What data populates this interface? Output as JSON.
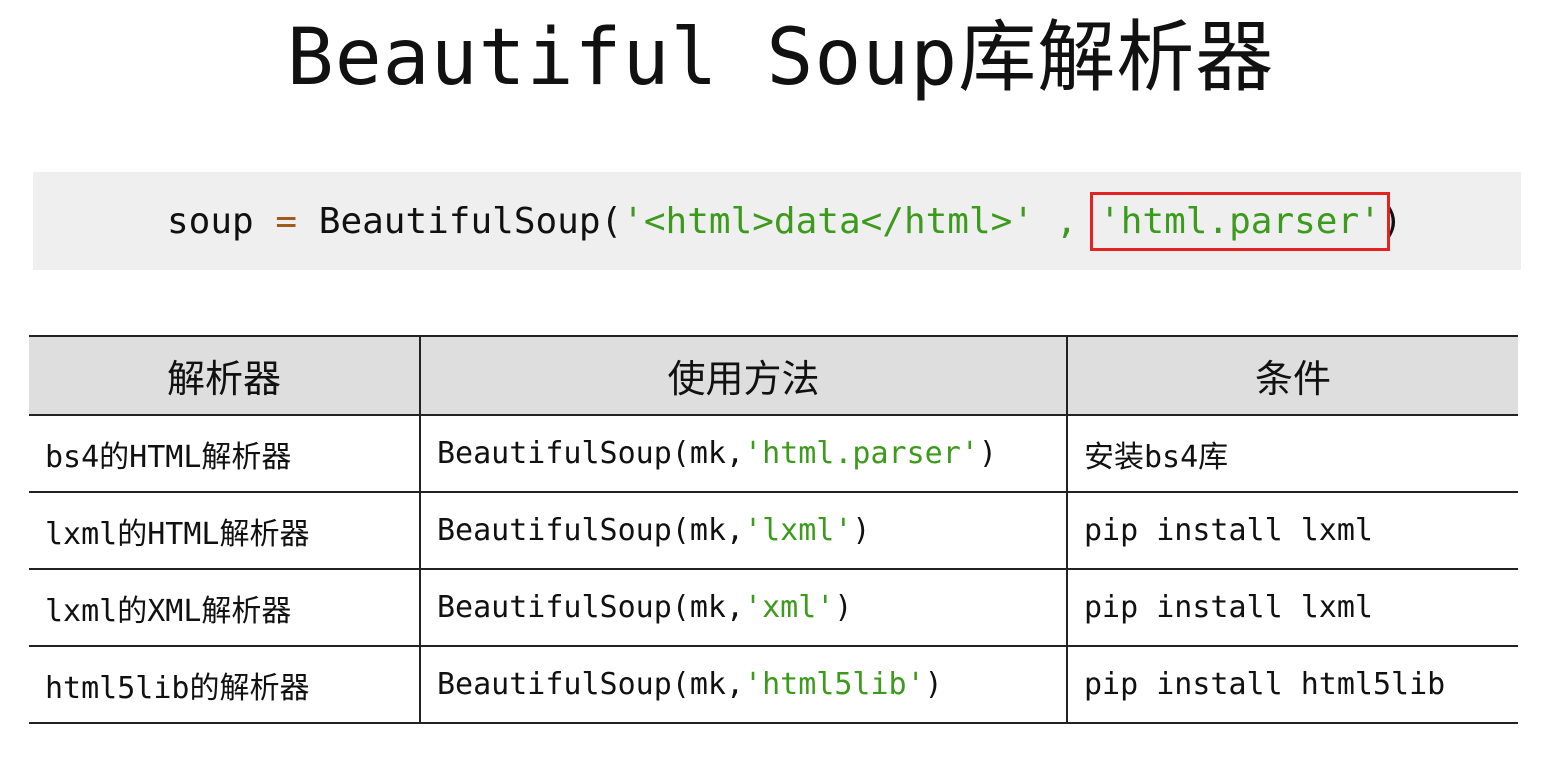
{
  "title": "Beautiful Soup库解析器",
  "code": {
    "var": "soup",
    "op": "=",
    "call": "BeautifulSoup(",
    "arg1": "'<html>data</html>'",
    "sep": " , ",
    "arg2": "'html.parser'",
    "close": ")"
  },
  "table": {
    "headers": [
      "解析器",
      "使用方法",
      "条件"
    ],
    "rows": [
      {
        "parser": "bs4的HTML解析器",
        "usage_prefix": "BeautifulSoup(mk,",
        "usage_arg": "'html.parser'",
        "usage_suffix": ")",
        "condition": "安装bs4库"
      },
      {
        "parser": "lxml的HTML解析器",
        "usage_prefix": "BeautifulSoup(mk,",
        "usage_arg": "'lxml'",
        "usage_suffix": ")",
        "condition": "pip install lxml"
      },
      {
        "parser": "lxml的XML解析器",
        "usage_prefix": "BeautifulSoup(mk,",
        "usage_arg": "'xml'",
        "usage_suffix": ")",
        "condition": "pip install lxml"
      },
      {
        "parser": "html5lib的解析器",
        "usage_prefix": "BeautifulSoup(mk,",
        "usage_arg": "'html5lib'",
        "usage_suffix": ")",
        "condition": "pip install html5lib"
      }
    ]
  },
  "colors": {
    "string": "#3c9a1c",
    "operator": "#a05a1a",
    "highlight_box": "#e32222",
    "header_bg": "#dedede",
    "code_bg": "#efefef"
  }
}
